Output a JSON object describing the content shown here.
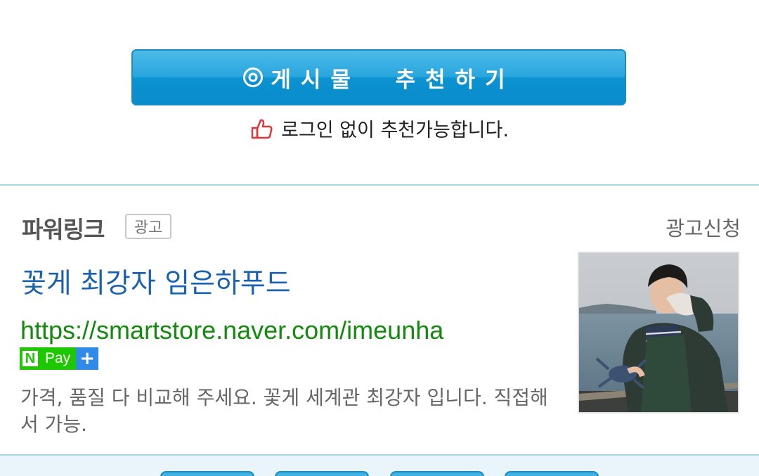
{
  "recommend": {
    "button_label": "게시물  추천하기",
    "note": "로그인 없이 추천가능합니다."
  },
  "powerlink": {
    "title": "파워링크",
    "ad_badge": "광고",
    "apply_link": "광고신청",
    "ad": {
      "title": "꽃게 최강자 임은하푸드",
      "url": "https://smartstore.naver.com/imeunha",
      "npay": {
        "n": "N",
        "pay": "Pay",
        "plus": "+"
      },
      "description": "가격, 품질 다 비교해 주세요. 꽃게 세계관 최강자 입니다. 직접해서 가능."
    }
  },
  "colors": {
    "recommend_button": "#0b92d1",
    "ad_title": "#1a62b0",
    "ad_url": "#138a0d",
    "npay_green": "#1ec800",
    "divider": "#a8d5e2"
  },
  "icons": [
    "target-circle-icon",
    "thumbs-up-icon",
    "npay-logo"
  ]
}
